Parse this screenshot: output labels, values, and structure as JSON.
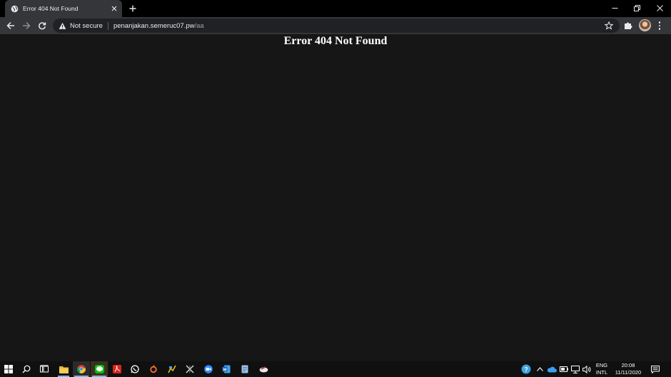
{
  "browser": {
    "tab": {
      "title": "Error 404 Not Found",
      "favicon": "globe-icon"
    },
    "toolbar": {
      "security_label": "Not secure",
      "url_host": "penanjakan.semeruc07.pw",
      "url_path": "/aa"
    }
  },
  "page": {
    "heading": "Error 404 Not Found",
    "background": "#161616"
  },
  "taskbar": {
    "apps": [
      "windows-start",
      "search",
      "task-view",
      "file-explorer",
      "chrome",
      "line",
      "acrobat-reader",
      "whatsapp",
      "origin",
      "app-7",
      "app-8",
      "zoom",
      "word",
      "app-11",
      "app-12"
    ],
    "language": {
      "line1": "ENG",
      "line2": "INTL"
    },
    "clock": {
      "time": "20:08",
      "date": "11/11/2020"
    }
  },
  "colors": {
    "accent": "#76b9ed",
    "tab_bg": "#35363a",
    "omnibox_bg": "#202124"
  }
}
